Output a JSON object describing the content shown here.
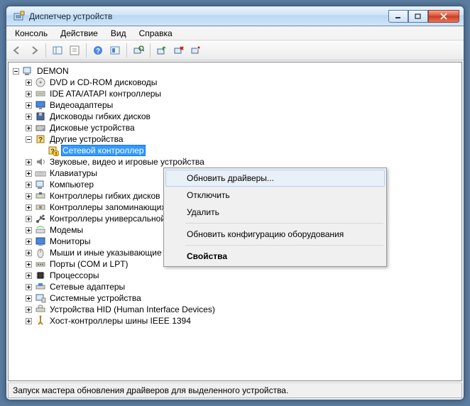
{
  "window": {
    "title": "Диспетчер устройств"
  },
  "menubar": {
    "items": [
      "Консоль",
      "Действие",
      "Вид",
      "Справка"
    ]
  },
  "tree": {
    "root": "DEMON",
    "nodes": [
      {
        "label": "DVD и CD-ROM дисководы",
        "icon": "disc"
      },
      {
        "label": "IDE ATA/ATAPI контроллеры",
        "icon": "ide"
      },
      {
        "label": "Видеоадаптеры",
        "icon": "display"
      },
      {
        "label": "Дисководы гибких дисков",
        "icon": "floppy"
      },
      {
        "label": "Дисковые устройства",
        "icon": "hdd"
      },
      {
        "label": "Другие устройства",
        "icon": "unknown",
        "expanded": true,
        "children": [
          {
            "label": "Сетевой контроллер",
            "icon": "unknown-warn",
            "selected": true
          }
        ]
      },
      {
        "label": "Звуковые, видео и игровые устройства",
        "icon": "sound"
      },
      {
        "label": "Клавиатуры",
        "icon": "keyboard"
      },
      {
        "label": "Компьютер",
        "icon": "computer"
      },
      {
        "label": "Контроллеры гибких дисков",
        "icon": "floppyctrl"
      },
      {
        "label": "Контроллеры запоминающих устройств",
        "icon": "storagectrl"
      },
      {
        "label": "Контроллеры универсальной последовательной шины USB",
        "icon": "usb"
      },
      {
        "label": "Модемы",
        "icon": "modem"
      },
      {
        "label": "Мониторы",
        "icon": "monitor"
      },
      {
        "label": "Мыши и иные указывающие устройства",
        "icon": "mouse"
      },
      {
        "label": "Порты (COM и LPT)",
        "icon": "port"
      },
      {
        "label": "Процессоры",
        "icon": "cpu"
      },
      {
        "label": "Сетевые адаптеры",
        "icon": "network"
      },
      {
        "label": "Системные устройства",
        "icon": "system"
      },
      {
        "label": "Устройства HID (Human Interface Devices)",
        "icon": "hid"
      },
      {
        "label": "Хост-контроллеры шины IEEE 1394",
        "icon": "firewire"
      }
    ]
  },
  "context_menu": {
    "items": [
      {
        "label": "Обновить драйверы...",
        "highlight": true
      },
      {
        "label": "Отключить"
      },
      {
        "label": "Удалить"
      },
      {
        "sep": true
      },
      {
        "label": "Обновить конфигурацию оборудования"
      },
      {
        "sep": true
      },
      {
        "label": "Свойства",
        "bold": true
      }
    ]
  },
  "statusbar": {
    "text": "Запуск мастера обновления драйверов для выделенного устройства."
  }
}
